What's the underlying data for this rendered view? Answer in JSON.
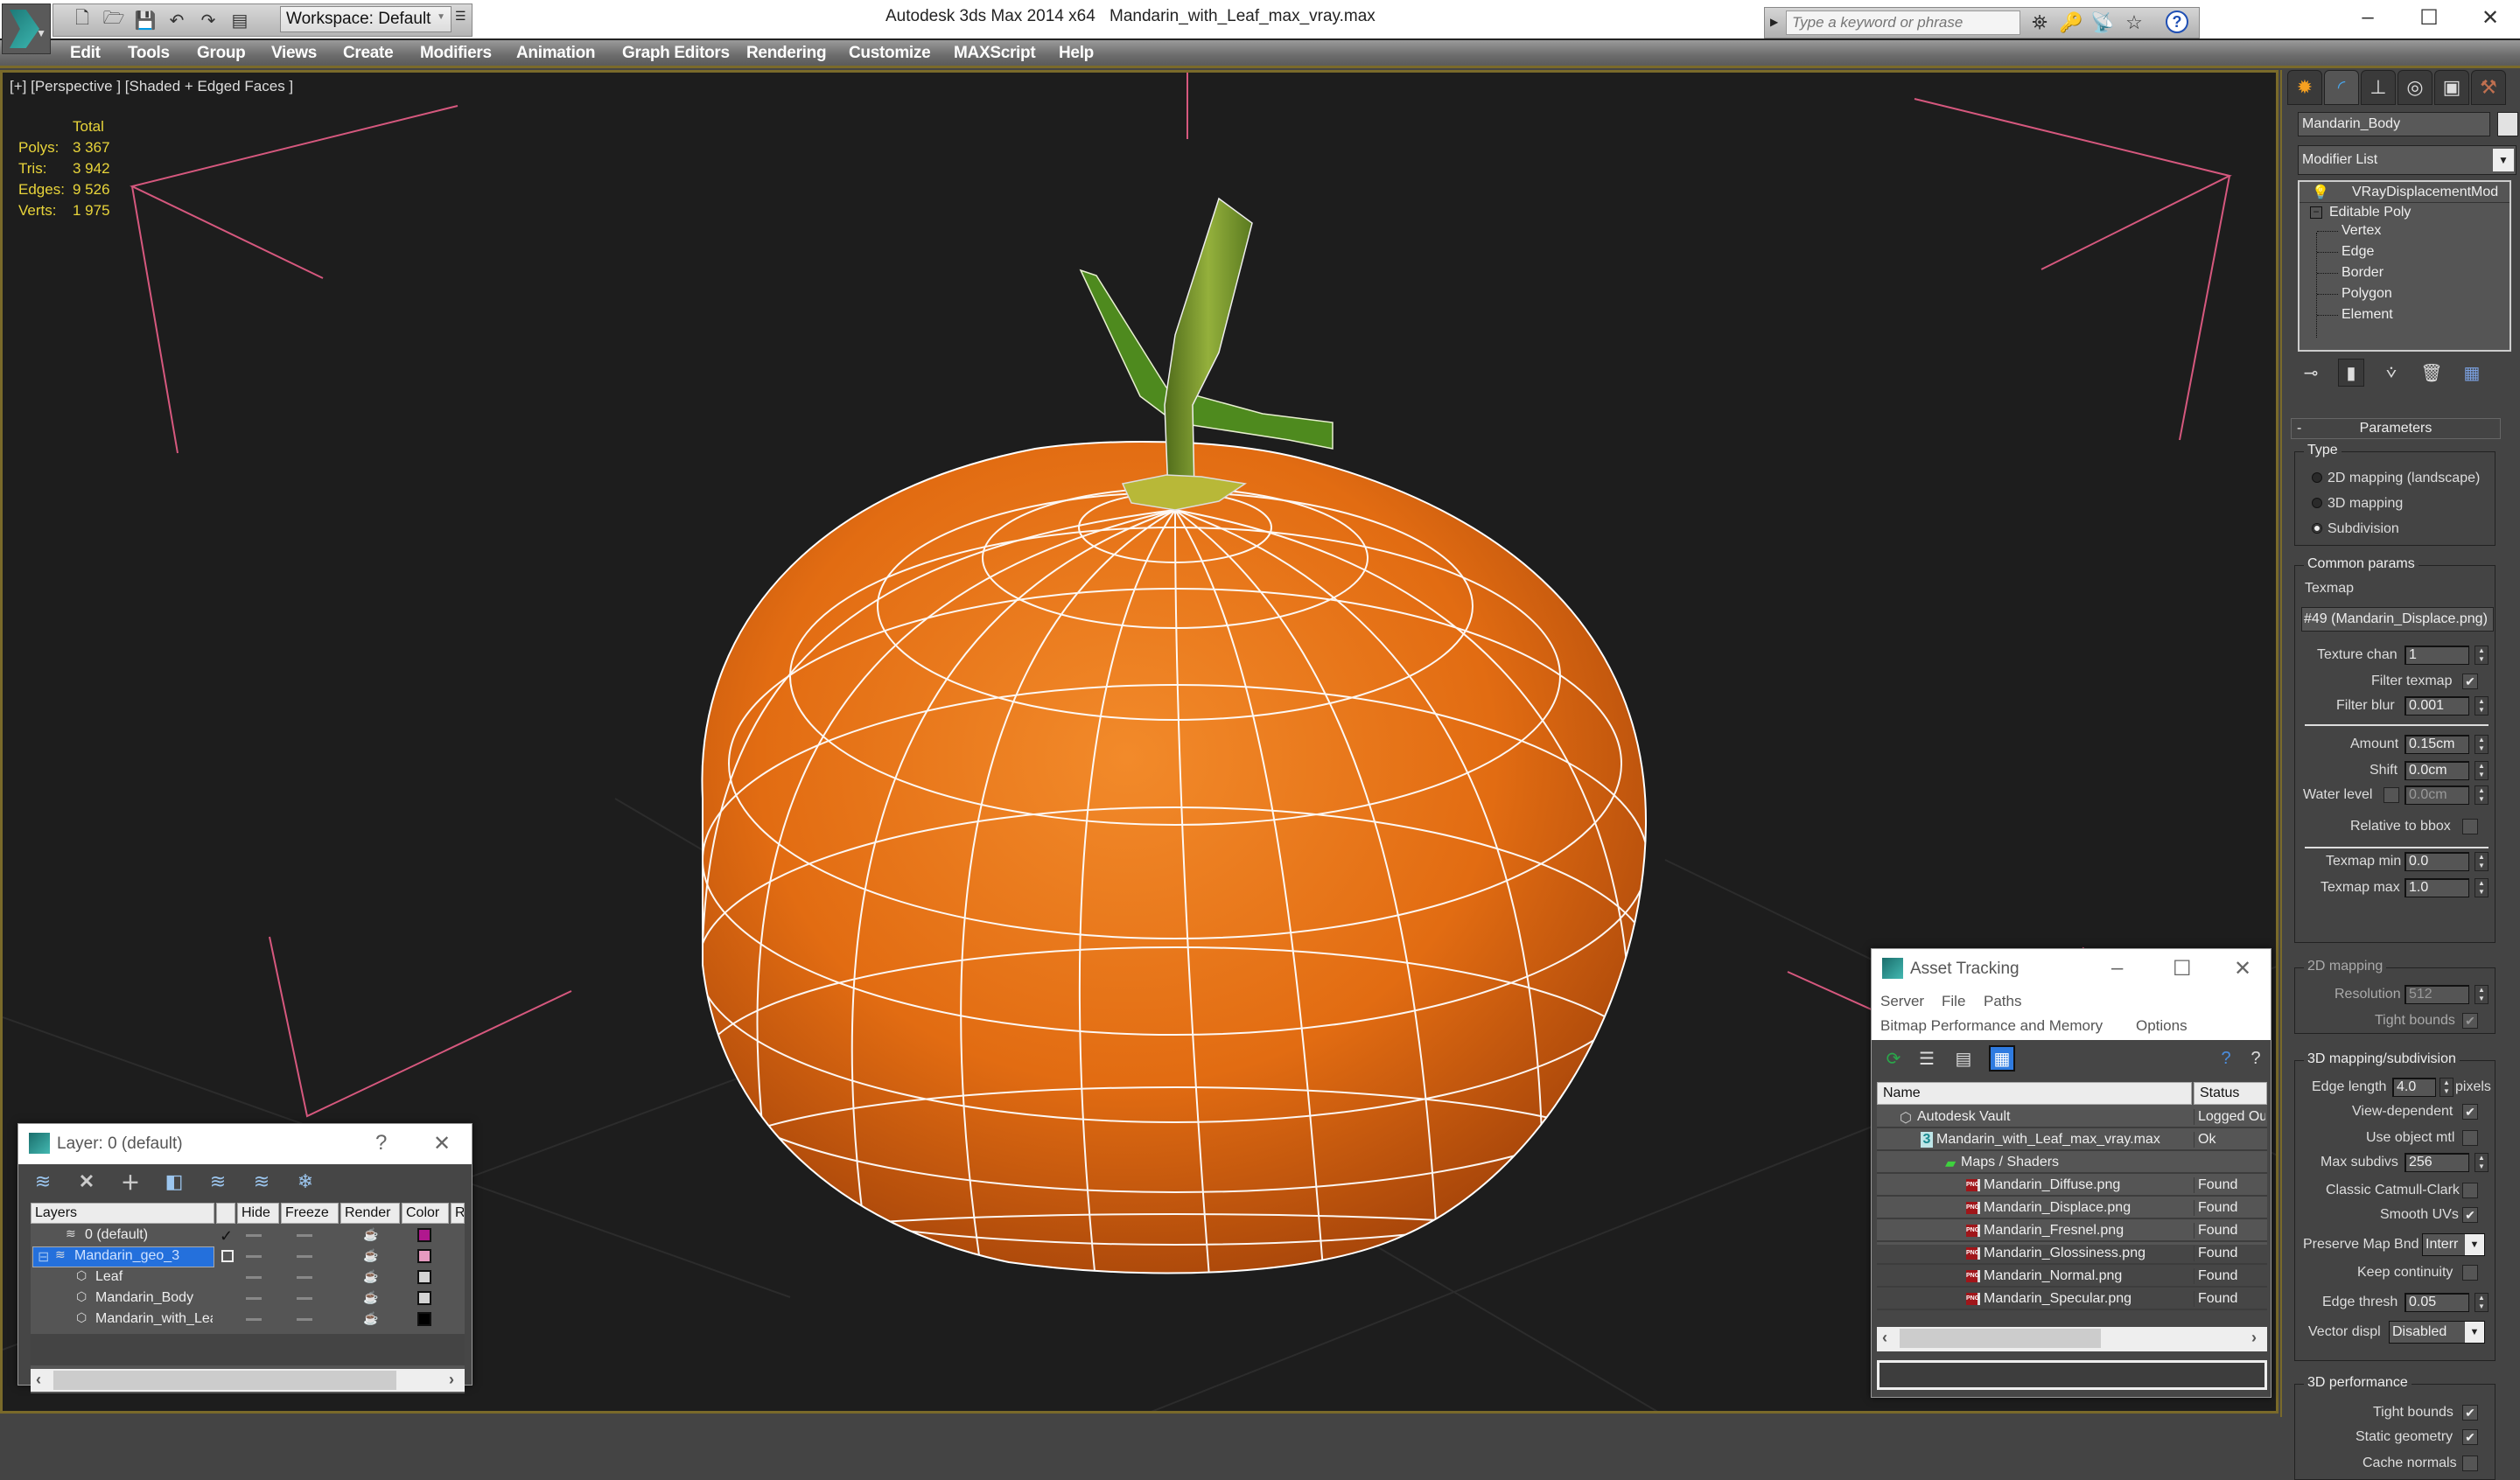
{
  "app": {
    "title": "Autodesk 3ds Max  2014 x64",
    "file": "Mandarin_with_Leaf_max_vray.max",
    "workspace": "Workspace: Default",
    "search_placeholder": "Type a keyword or phrase",
    "qat_icons": [
      "new-file-icon",
      "open-folder-icon",
      "save-icon",
      "undo-icon",
      "redo-icon",
      "project-folder-icon"
    ],
    "window_controls": {
      "minimize": "–",
      "maximize": "☐",
      "close": "✕"
    }
  },
  "menu": [
    "Edit",
    "Tools",
    "Group",
    "Views",
    "Create",
    "Modifiers",
    "Animation",
    "Graph Editors",
    "Rendering",
    "Customize",
    "MAXScript",
    "Help"
  ],
  "viewport": {
    "label": "[+] [Perspective ] [Shaded + Edged Faces ]",
    "stats": {
      "header": "Total",
      "rows": [
        {
          "label": "Polys:",
          "value": "3 367"
        },
        {
          "label": "Tris:",
          "value": "3 942"
        },
        {
          "label": "Edges:",
          "value": "9 526"
        },
        {
          "label": "Verts:",
          "value": "1 975"
        }
      ]
    },
    "colors": {
      "background": "#1d1d1d",
      "fruit": "#e0731a",
      "wire": "#ffffff",
      "selection_bracket": "#d6587e",
      "stem": "#6a8a2a"
    }
  },
  "command_panel": {
    "tabs": [
      "create-tab",
      "modify-tab",
      "hierarchy-tab",
      "motion-tab",
      "display-tab",
      "utilities-tab"
    ],
    "object_name": "Mandarin_Body",
    "modifier_list": "Modifier List",
    "stack": {
      "top": "VRayDisplacementMod",
      "base": "Editable Poly",
      "subobjects": [
        "Vertex",
        "Edge",
        "Border",
        "Polygon",
        "Element"
      ]
    },
    "rollout_title": "Parameters",
    "type_group": {
      "label": "Type",
      "options": [
        "2D mapping (landscape)",
        "3D mapping",
        "Subdivision"
      ],
      "selected": "Subdivision"
    },
    "common": {
      "label": "Common params",
      "texmap_label": "Texmap",
      "texmap_value": "#49 (Mandarin_Displace.png)",
      "texture_chan_label": "Texture chan",
      "texture_chan": "1",
      "filter_texmap_label": "Filter texmap",
      "filter_texmap": true,
      "filter_blur_label": "Filter blur",
      "filter_blur": "0.001",
      "amount_label": "Amount",
      "amount": "0.15cm",
      "shift_label": "Shift",
      "shift": "0.0cm",
      "water_level_label": "Water level",
      "water_level_enabled": false,
      "water_level": "0.0cm",
      "relative_bbox_label": "Relative to bbox",
      "relative_bbox": false,
      "texmap_min_label": "Texmap min",
      "texmap_min": "0.0",
      "texmap_max_label": "Texmap max",
      "texmap_max": "1.0"
    },
    "mapping2d": {
      "label": "2D mapping",
      "resolution_label": "Resolution",
      "resolution": "512",
      "tight_bounds_label": "Tight bounds",
      "tight_bounds": true
    },
    "mapping3d": {
      "label": "3D mapping/subdivision",
      "edge_length_label": "Edge length",
      "edge_length": "4.0",
      "pixels_label": "pixels",
      "view_dependent_label": "View-dependent",
      "view_dependent": true,
      "use_object_mtl_label": "Use object mtl",
      "use_object_mtl": false,
      "max_subdivs_label": "Max subdivs",
      "max_subdivs": "256",
      "catmull_label": "Classic Catmull-Clark",
      "catmull": false,
      "smooth_uvs_label": "Smooth UVs",
      "smooth_uvs": true,
      "preserve_label": "Preserve Map Bnd",
      "preserve_value": "Interr",
      "keep_continuity_label": "Keep continuity",
      "keep_continuity": false,
      "edge_thresh_label": "Edge thresh",
      "edge_thresh": "0.05",
      "vector_displ_label": "Vector displ",
      "vector_displ": "Disabled"
    },
    "performance": {
      "label": "3D performance",
      "tight_bounds_label": "Tight bounds",
      "tight_bounds": true,
      "static_geometry_label": "Static geometry",
      "static_geometry": true,
      "cache_normals_label": "Cache normals",
      "cache_normals": false
    }
  },
  "layer_dialog": {
    "title": "Layer: 0 (default)",
    "help": "?",
    "close": "✕",
    "columns": [
      "Layers",
      "",
      "Hide",
      "Freeze",
      "Render",
      "Color",
      "Ra"
    ],
    "rows": [
      {
        "name": "0 (default)",
        "type": "layer",
        "current": true,
        "color": "#b0188e",
        "selected": false
      },
      {
        "name": "Mandarin_geo_3",
        "type": "layer",
        "current": false,
        "color": "#e79ac0",
        "selected": true
      },
      {
        "name": "Leaf",
        "type": "object",
        "color": "#d4d4d4",
        "selected": false
      },
      {
        "name": "Mandarin_Body",
        "type": "object",
        "color": "#d4d4d4",
        "selected": false
      },
      {
        "name": "Mandarin_with_Lea",
        "type": "object",
        "color": "#000000",
        "selected": false
      }
    ]
  },
  "asset_dialog": {
    "title": "Asset Tracking",
    "menu_row1": [
      "Server",
      "File",
      "Paths"
    ],
    "menu_row2": [
      "Bitmap Performance and Memory",
      "Options"
    ],
    "columns": [
      "Name",
      "Status"
    ],
    "rows": [
      {
        "name": "Autodesk Vault",
        "status": "Logged Out",
        "indent": 0,
        "icon": "vault-icon"
      },
      {
        "name": "Mandarin_with_Leaf_max_vray.max",
        "status": "Ok",
        "indent": 1,
        "icon": "max-file-icon"
      },
      {
        "name": "Maps / Shaders",
        "status": "",
        "indent": 2,
        "icon": "maps-icon"
      },
      {
        "name": "Mandarin_Diffuse.png",
        "status": "Found",
        "indent": 3,
        "icon": "png-icon"
      },
      {
        "name": "Mandarin_Displace.png",
        "status": "Found",
        "indent": 3,
        "icon": "png-icon"
      },
      {
        "name": "Mandarin_Fresnel.png",
        "status": "Found",
        "indent": 3,
        "icon": "png-icon"
      },
      {
        "name": "Mandarin_Glossiness.png",
        "status": "Found",
        "indent": 3,
        "icon": "png-icon"
      },
      {
        "name": "Mandarin_Normal.png",
        "status": "Found",
        "indent": 3,
        "icon": "png-icon"
      },
      {
        "name": "Mandarin_Specular.png",
        "status": "Found",
        "indent": 3,
        "icon": "png-icon"
      }
    ]
  }
}
